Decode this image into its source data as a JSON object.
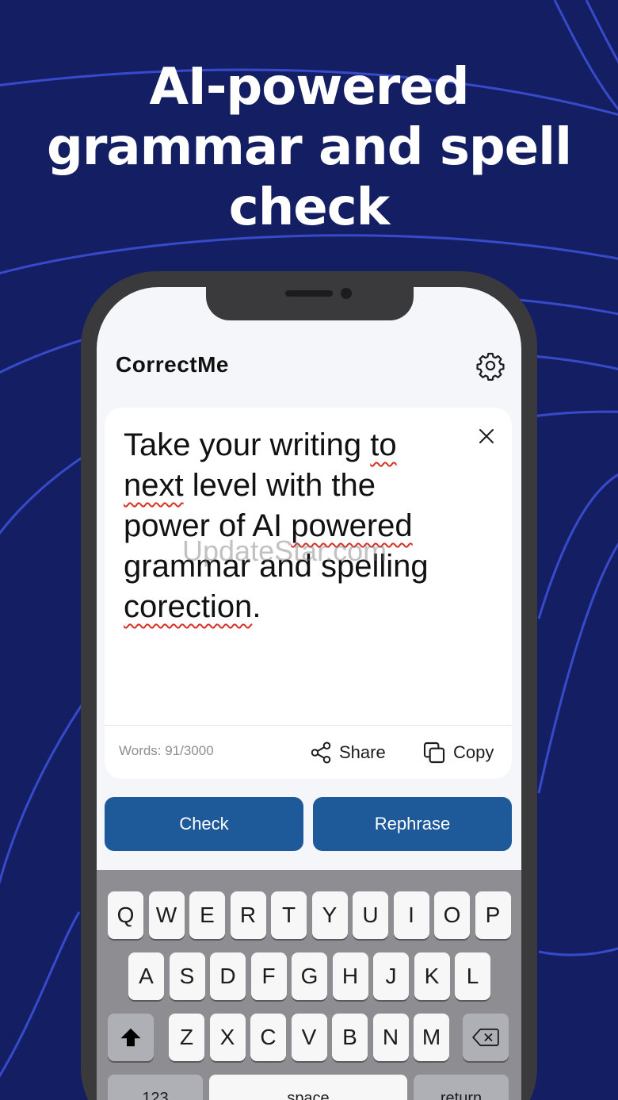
{
  "promo": {
    "headline": [
      "AI-powered",
      "grammar and spell",
      "check"
    ]
  },
  "app": {
    "title": "CorrectMe"
  },
  "editor": {
    "segments": [
      {
        "text": "Take your writing ",
        "flag": false
      },
      {
        "text": "to",
        "flag": true
      },
      {
        "text": " ",
        "flag": false
      },
      {
        "text": "next",
        "flag": true
      },
      {
        "text": " level with the power of AI ",
        "flag": false
      },
      {
        "text": "powered",
        "flag": true
      },
      {
        "text": " grammar and spelling ",
        "flag": false
      },
      {
        "text": "corection",
        "flag": true
      },
      {
        "text": ".",
        "flag": false
      }
    ]
  },
  "watermark": "UpdateStar.com",
  "footer": {
    "word_count": "Words: 91/3000",
    "share_label": "Share",
    "copy_label": "Copy"
  },
  "actions": {
    "check_label": "Check",
    "rephrase_label": "Rephrase"
  },
  "keyboard": {
    "row1": [
      "Q",
      "W",
      "E",
      "R",
      "T",
      "Y",
      "U",
      "I",
      "O",
      "P"
    ],
    "row2": [
      "A",
      "S",
      "D",
      "F",
      "G",
      "H",
      "J",
      "K",
      "L"
    ],
    "row3": [
      "Z",
      "X",
      "C",
      "V",
      "B",
      "N",
      "M"
    ],
    "numbers_label": "123",
    "space_label": "space",
    "return_label": "return"
  },
  "colors": {
    "background": "#141f63",
    "accent": "#1e5a99",
    "squiggle": "#d93025"
  }
}
